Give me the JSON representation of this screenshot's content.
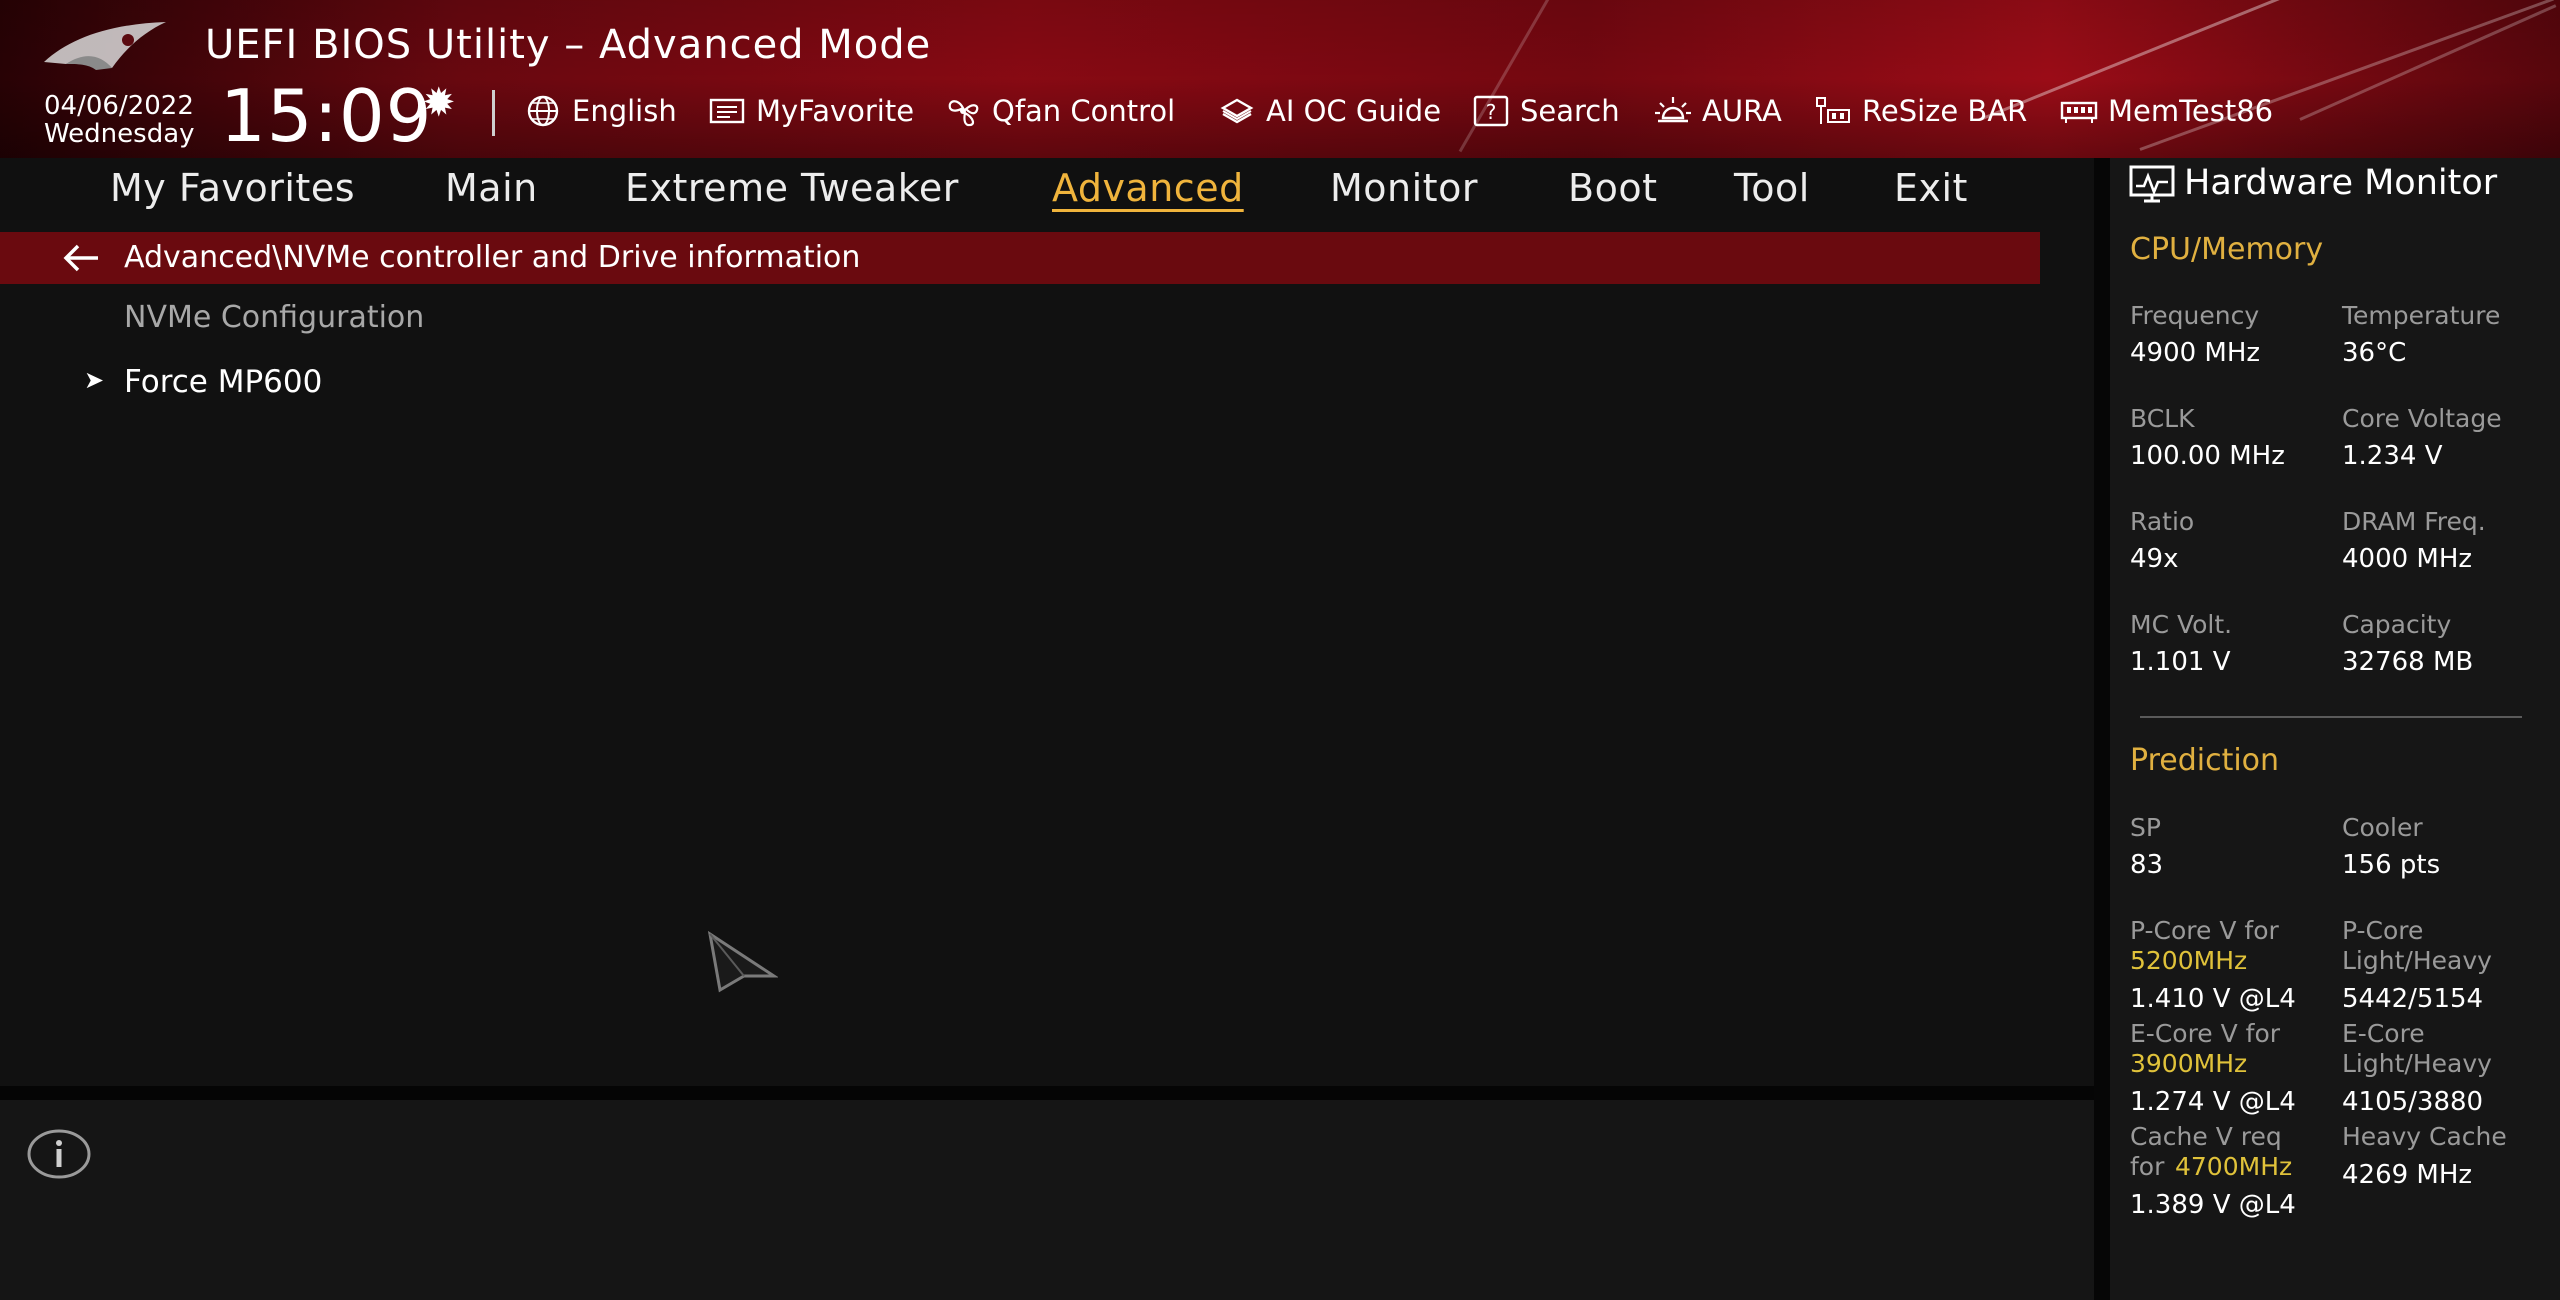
{
  "header": {
    "title": "UEFI BIOS Utility – Advanced Mode",
    "date": "04/06/2022",
    "weekday": "Wednesday",
    "time": "15:09",
    "toolbar": [
      {
        "label": "English",
        "icon": "globe-icon"
      },
      {
        "label": "MyFavorite",
        "icon": "favorite-icon"
      },
      {
        "label": "Qfan Control",
        "icon": "fan-icon"
      },
      {
        "label": "AI OC Guide",
        "icon": "ai-chip-icon"
      },
      {
        "label": "Search",
        "icon": "search-icon"
      },
      {
        "label": "AURA",
        "icon": "aura-icon"
      },
      {
        "label": "ReSize BAR",
        "icon": "resize-bar-icon"
      },
      {
        "label": "MemTest86",
        "icon": "memory-icon"
      }
    ]
  },
  "menu": {
    "items": [
      "My Favorites",
      "Main",
      "Extreme Tweaker",
      "Advanced",
      "Monitor",
      "Boot",
      "Tool",
      "Exit"
    ],
    "active": "Advanced"
  },
  "content": {
    "breadcrumb": "Advanced\\NVMe controller and Drive information",
    "section_label": "NVMe Configuration",
    "items": [
      {
        "label": "Force MP600",
        "icon": "submenu-arrow-icon"
      }
    ]
  },
  "hardware_monitor": {
    "title": "Hardware Monitor",
    "cpu_memory": {
      "heading": "CPU/Memory",
      "fields": [
        {
          "label": "Frequency",
          "value": "4900 MHz"
        },
        {
          "label": "Temperature",
          "value": "36°C"
        },
        {
          "label": "BCLK",
          "value": "100.00 MHz"
        },
        {
          "label": "Core Voltage",
          "value": "1.234 V"
        },
        {
          "label": "Ratio",
          "value": "49x"
        },
        {
          "label": "DRAM Freq.",
          "value": "4000 MHz"
        },
        {
          "label": "MC Volt.",
          "value": "1.101 V"
        },
        {
          "label": "Capacity",
          "value": "32768 MB"
        }
      ]
    },
    "prediction": {
      "heading": "Prediction",
      "sp_label": "SP",
      "sp_value": "83",
      "cooler_label": "Cooler",
      "cooler_value": "156 pts",
      "pcore_label": "P-Core V for",
      "pcore_freq": "5200MHz",
      "pcore_value": "1.410 V @L4",
      "pcore_lh_label_1": "P-Core",
      "pcore_lh_label_2": "Light/Heavy",
      "pcore_lh_value": "5442/5154",
      "ecore_label": "E-Core V for",
      "ecore_freq": "3900MHz",
      "ecore_value": "1.274 V @L4",
      "ecore_lh_label_1": "E-Core",
      "ecore_lh_label_2": "Light/Heavy",
      "ecore_lh_value": "4105/3880",
      "cache_label": "Cache V req",
      "cache_for": "for",
      "cache_freq": "4700MHz",
      "cache_value": "1.389 V @L4",
      "heavy_cache_label": "Heavy Cache",
      "heavy_cache_value": "4269 MHz"
    }
  },
  "colors": {
    "header_red": "#8f0a14",
    "breadcrumb_bg": "#6a0a0f",
    "accent_gold": "#f0b43c",
    "monitor_heading": "#e0b040",
    "prediction_highlight": "#e0c23a"
  }
}
